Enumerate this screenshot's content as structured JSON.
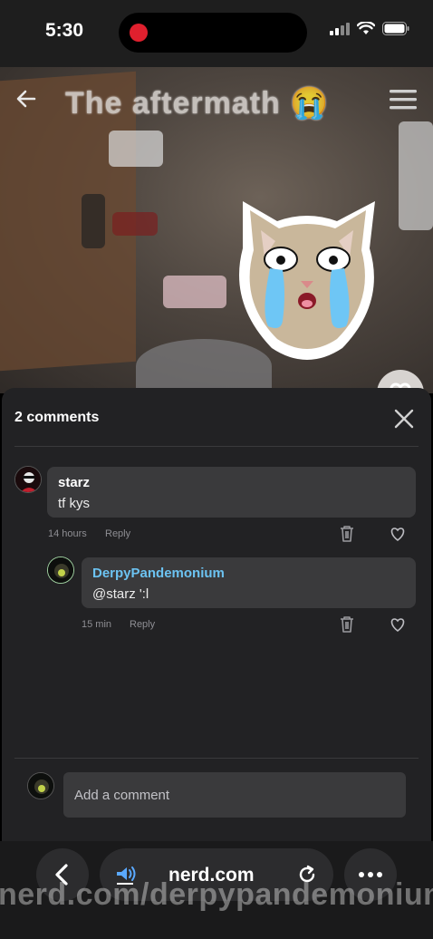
{
  "status_bar": {
    "time": "5:30"
  },
  "video": {
    "title": "The aftermath 😭"
  },
  "comments_panel": {
    "title": "2 comments",
    "comments": [
      {
        "author": "starz",
        "text": "tf kys",
        "time": "14 hours",
        "reply_label": "Reply",
        "author_color": "#ffffff"
      },
      {
        "author": "DerpyPandemonium",
        "text": "@starz  ':l",
        "time": "15 min",
        "reply_label": "Reply",
        "author_color": "#6cc3f2"
      }
    ],
    "input_placeholder": "Add a comment"
  },
  "browser": {
    "url": "nerd.com",
    "watermark": "nerd.com/derpypandemonium"
  },
  "colors": {
    "sheet_bg": "#222224",
    "bubble_bg": "#3a3a3c",
    "accent": "#6cc3f2",
    "record": "#e0202e"
  },
  "icons": [
    "back-arrow-icon",
    "menu-icon",
    "close-icon",
    "trash-icon",
    "heart-icon",
    "speaker-icon",
    "reload-icon",
    "more-icon"
  ]
}
